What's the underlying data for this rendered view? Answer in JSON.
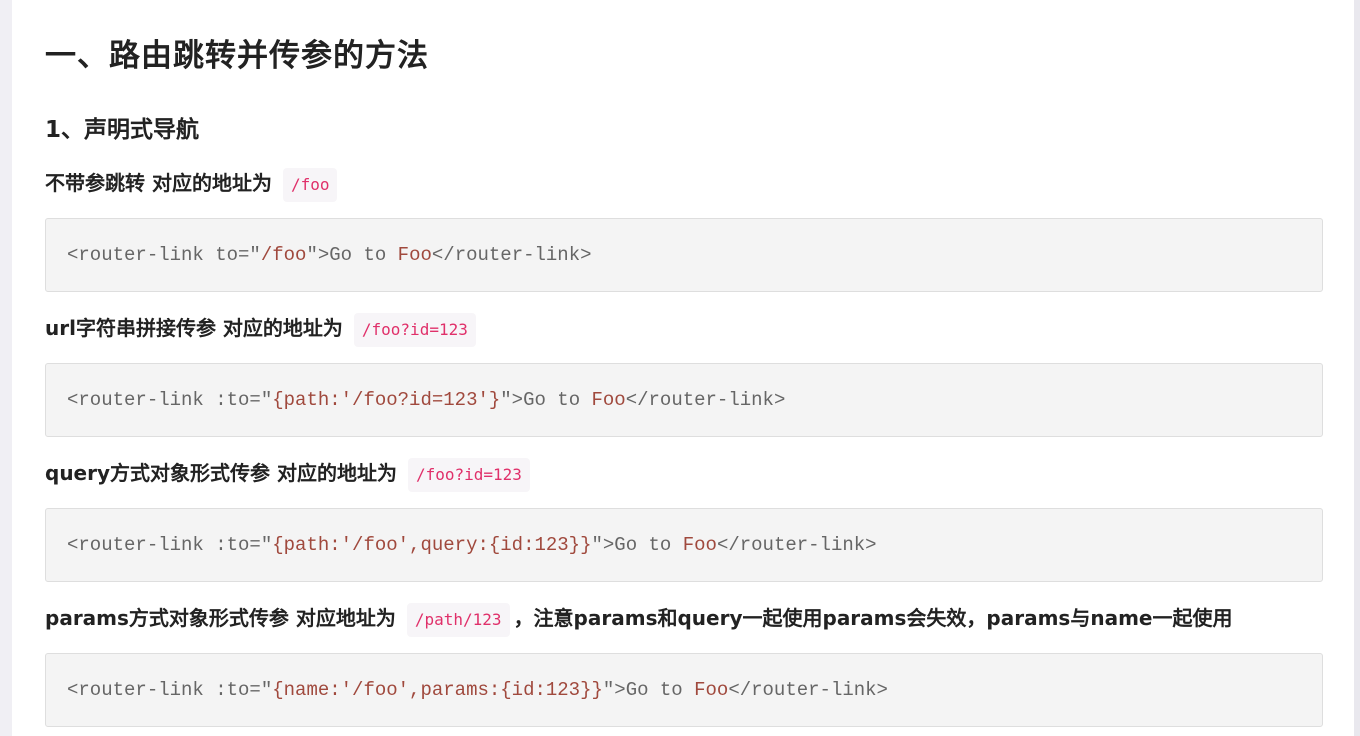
{
  "heading": "一、路由跳转并传参的方法",
  "subheading": "1、声明式导航",
  "sections": [
    {
      "text": "不带参跳转 对应的地址为",
      "code": "/foo",
      "after": "",
      "block": {
        "p1": "<router-link to=\"",
        "s1": "/foo",
        "p2": "\">Go to ",
        "s2": "Foo",
        "p3": "</router-link>"
      }
    },
    {
      "text": "url字符串拼接传参 对应的地址为",
      "code": "/foo?id=123",
      "after": "",
      "block": {
        "p1": "<router-link :to=\"",
        "s1": "{path:'/foo?id=123'}",
        "p2": "\">Go to ",
        "s2": "Foo",
        "p3": "</router-link>"
      }
    },
    {
      "text": "query方式对象形式传参 对应的地址为",
      "code": "/foo?id=123",
      "after": "",
      "block": {
        "p1": "<router-link :to=\"",
        "s1": "{path:'/foo',query:{id:123}}",
        "p2": "\">Go to ",
        "s2": "Foo",
        "p3": "</router-link>"
      }
    },
    {
      "text": "params方式对象形式传参 对应地址为",
      "code": "/path/123",
      "after": "，注意params和query一起使用params会失效，params与name一起使用",
      "block": {
        "p1": "<router-link :to=\"",
        "s1": "{name:'/foo',params:{id:123}}",
        "p2": "\">Go to ",
        "s2": "Foo",
        "p3": "</router-link>"
      }
    }
  ]
}
